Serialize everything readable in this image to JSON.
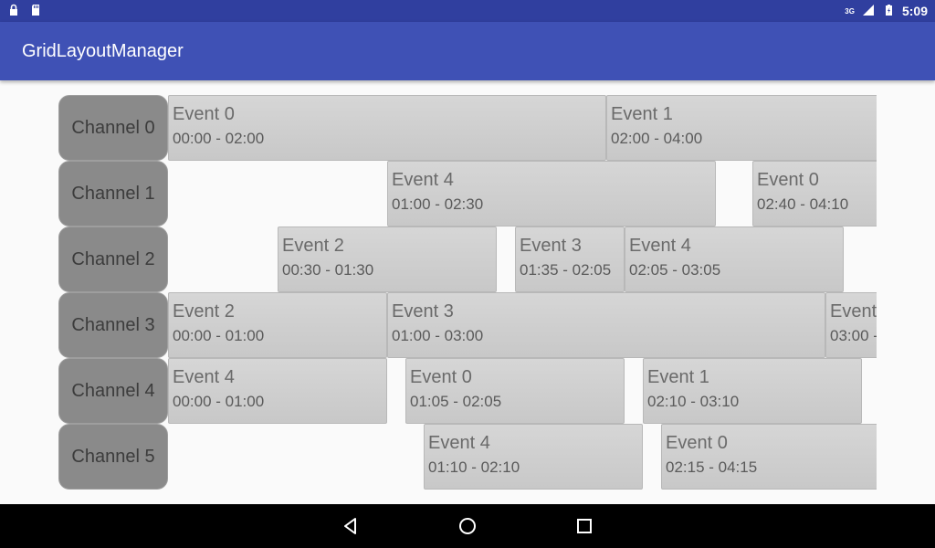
{
  "status_bar": {
    "time": "5:09",
    "network": "3G",
    "left_icons": [
      "lock-icon",
      "sd-card-icon"
    ],
    "right_icons": [
      "signal-icon",
      "battery-icon"
    ]
  },
  "app_bar": {
    "title": "GridLayoutManager",
    "color": "#3f51b5"
  },
  "channels": [
    {
      "label": "Channel 0",
      "events": [
        {
          "title": "Event 0",
          "time": "00:00 - 02:00"
        },
        {
          "title": "Event 1",
          "time": "02:00 - 04:00"
        }
      ]
    },
    {
      "label": "Channel 1",
      "events": [
        {
          "title": "Event 4",
          "time": "01:00 - 02:30"
        },
        {
          "title": "Event 0",
          "time": "02:40 - 04:10"
        }
      ]
    },
    {
      "label": "Channel 2",
      "events": [
        {
          "title": "Event 2",
          "time": "00:30 - 01:30"
        },
        {
          "title": "Event 3",
          "time": "01:35 - 02:05"
        },
        {
          "title": "Event 4",
          "time": "02:05 - 03:05"
        }
      ]
    },
    {
      "label": "Channel 3",
      "events": [
        {
          "title": "Event 2",
          "time": "00:00 - 01:00"
        },
        {
          "title": "Event 3",
          "time": "01:00 - 03:00"
        },
        {
          "title": "Event",
          "time": "03:00 -"
        }
      ]
    },
    {
      "label": "Channel 4",
      "events": [
        {
          "title": "Event 4",
          "time": "00:00 - 01:00"
        },
        {
          "title": "Event 0",
          "time": "01:05 - 02:05"
        },
        {
          "title": "Event 1",
          "time": "02:10 - 03:10"
        }
      ]
    },
    {
      "label": "Channel 5",
      "events": [
        {
          "title": "Event 4",
          "time": "01:10 - 02:10"
        },
        {
          "title": "Event 0",
          "time": "02:15 - 04:15"
        }
      ]
    }
  ],
  "nav_bar": {
    "buttons": [
      "back-icon",
      "home-icon",
      "recents-icon"
    ]
  }
}
